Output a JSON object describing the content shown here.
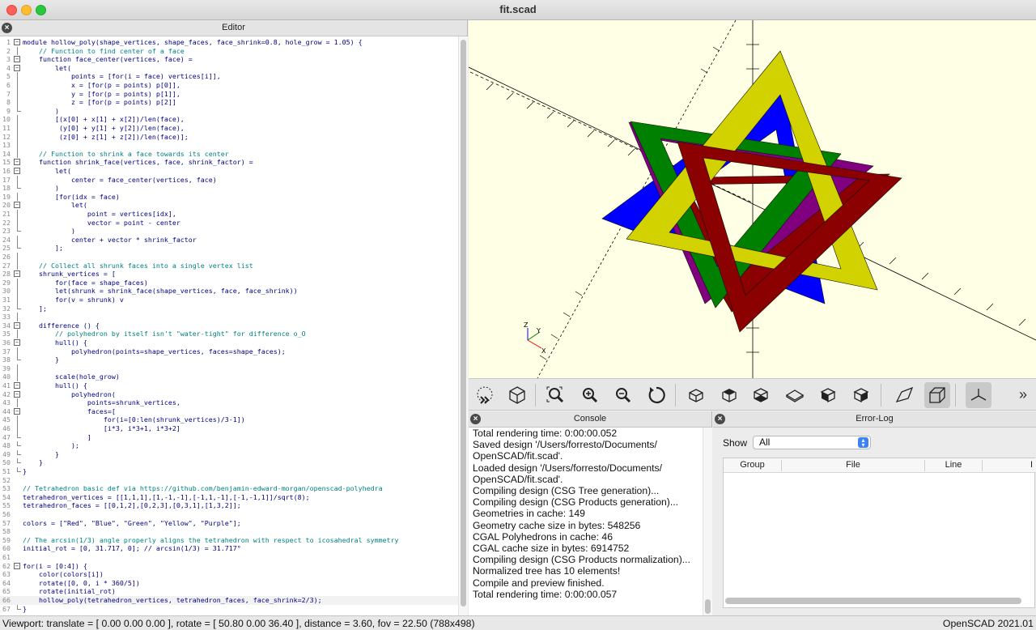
{
  "window": {
    "title": "fit.scad"
  },
  "editor": {
    "title": "Editor",
    "current_line": 66,
    "lines": [
      "module hollow_poly(shape_vertices, shape_faces, face_shrink=0.8, hole_grow = 1.05) {",
      "    // Function to find center of a face",
      "    function face_center(vertices, face) =",
      "        let(",
      "            points = [for(i = face) vertices[i]],",
      "            x = [for(p = points) p[0]],",
      "            y = [for(p = points) p[1]],",
      "            z = [for(p = points) p[2]]",
      "        )",
      "        [(x[0] + x[1] + x[2])/len(face),",
      "         (y[0] + y[1] + y[2])/len(face),",
      "         (z[0] + z[1] + z[2])/len(face)];",
      "",
      "    // Function to shrink a face towards its center",
      "    function shrink_face(vertices, face, shrink_factor) =",
      "        let(",
      "            center = face_center(vertices, face)",
      "        )",
      "        [for(idx = face)",
      "            let(",
      "                point = vertices[idx],",
      "                vector = point - center",
      "            )",
      "            center + vector * shrink_factor",
      "        ];",
      "",
      "    // Collect all shrunk faces into a single vertex list",
      "    shrunk_vertices = [",
      "        for(face = shape_faces)",
      "        let(shrunk = shrink_face(shape_vertices, face, face_shrink))",
      "        for(v = shrunk) v",
      "    ];",
      "",
      "    difference () {",
      "        // polyhedron by itself isn't \"water-tight\" for difference o_O",
      "        hull() {",
      "            polyhedron(points=shape_vertices, faces=shape_faces);",
      "        }",
      "",
      "        scale(hole_grow)",
      "        hull() {",
      "            polyhedron(",
      "                points=shrunk_vertices,",
      "                faces=[",
      "                    for(i=[0:len(shrunk_vertices)/3-1])",
      "                    [i*3, i*3+1, i*3+2]",
      "                ]",
      "            );",
      "        }",
      "    }",
      "}",
      "",
      "// Tetrahedron basic def via https://github.com/benjamin-edward-morgan/openscad-polyhedra",
      "tetrahedron_vertices = [[1,1,1],[1,-1,-1],[-1,1,-1],[-1,-1,1]]/sqrt(8);",
      "tetrahedron_faces = [[0,1,2],[0,2,3],[0,3,1],[1,3,2]];",
      "",
      "colors = [\"Red\", \"Blue\", \"Green\", \"Yellow\", \"Purple\"];",
      "",
      "// The arcsin(1/3) angle properly aligns the tetrahedron with respect to icosahedral symmetry",
      "initial_rot = [0, 31.717, 0]; // arcsin(1/3) = 31.717°",
      "",
      "for(i = [0:4]) {",
      "    color(colors[i])",
      "    rotate([0, 0, i * 360/5])",
      "    rotate(initial_rot)",
      "    hollow_poly(tetrahedron_vertices, tetrahedron_faces, face_shrink=2/3);",
      "}"
    ]
  },
  "viewport": {
    "axis_labels": {
      "x": "X",
      "y": "Y",
      "z": "Z"
    },
    "colors": {
      "red": "#8b0000",
      "blue": "#0000ff",
      "green": "#008000",
      "yellow": "#d2d200",
      "purple": "#800080",
      "background": "#ffffe5"
    }
  },
  "toolbar": {
    "icons": [
      "preview-icon",
      "render-icon",
      "view-all-icon",
      "zoom-in-icon",
      "zoom-out-icon",
      "reset-view-icon",
      "view-right-icon",
      "view-top-icon",
      "view-bottom-icon",
      "view-left-icon",
      "view-front-icon",
      "view-back-icon",
      "perspective-icon",
      "orthogonal-icon",
      "show-axes-icon",
      "more-icon"
    ],
    "overflow": "»"
  },
  "console": {
    "title": "Console",
    "lines": [
      "Total rendering time: 0:00:00.052",
      "Saved design '/Users/forresto/Documents/",
      "OpenSCAD/fit.scad'.",
      "Loaded design '/Users/forresto/Documents/",
      "OpenSCAD/fit.scad'.",
      "Compiling design (CSG Tree generation)...",
      "Compiling design (CSG Products generation)...",
      "Geometries in cache: 149",
      "Geometry cache size in bytes: 548256",
      "CGAL Polyhedrons in cache: 46",
      "CGAL cache size in bytes: 6914752",
      "Compiling design (CSG Products normalization)...",
      "Normalized tree has 10 elements!",
      "Compile and preview finished.",
      "Total rendering time: 0:00:00.057"
    ]
  },
  "errorlog": {
    "title": "Error-Log",
    "show_label": "Show",
    "show_value": "All",
    "columns": [
      "Group",
      "File",
      "Line",
      "I"
    ]
  },
  "statusbar": {
    "viewport_info": "Viewport: translate = [ 0.00 0.00 0.00 ], rotate = [ 50.80 0.00 36.40 ], distance = 3.60, fov = 22.50 (788x498)",
    "version": "OpenSCAD 2021.01"
  }
}
